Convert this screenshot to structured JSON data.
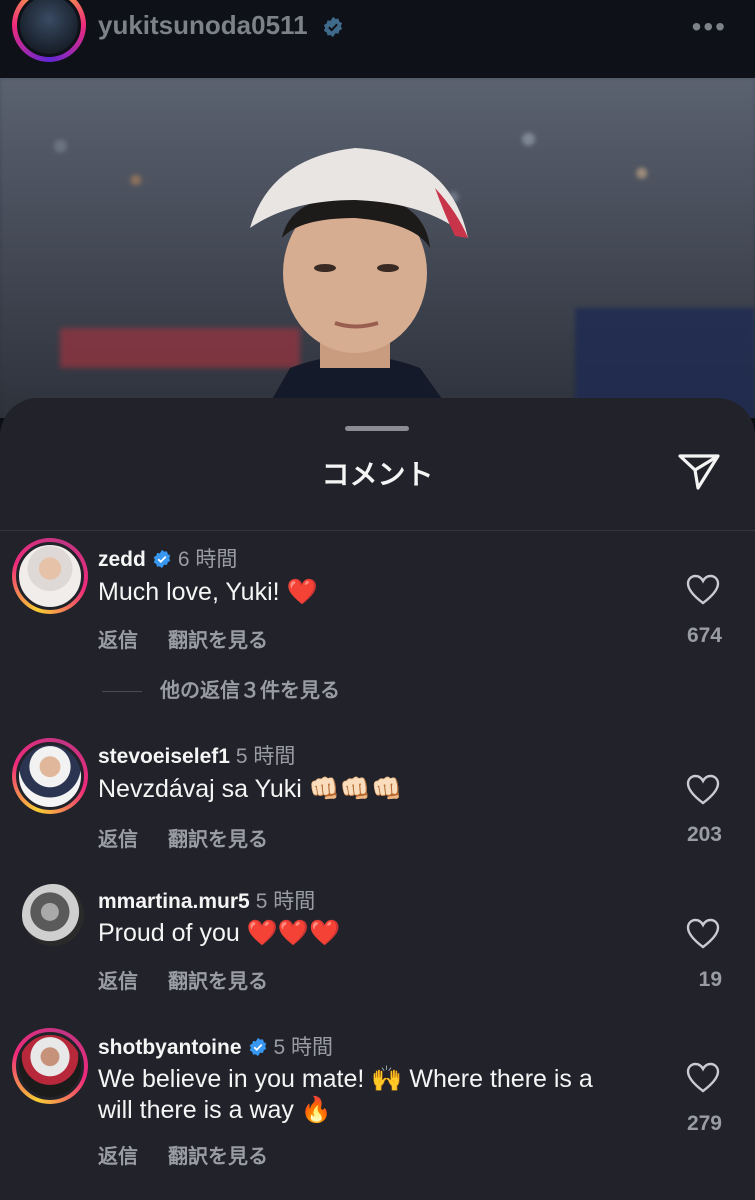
{
  "post": {
    "username": "yukitsunoda0511",
    "more_icon": "more-horizontal-icon"
  },
  "sheet": {
    "title": "コメント",
    "send_icon": "send-icon"
  },
  "comments": [
    {
      "user": "zedd",
      "verified": true,
      "time": "6 時間",
      "text": "Much love, Yuki!",
      "emoji": "❤️",
      "reply": "返信",
      "translate": "翻訳を見る",
      "likes": "674",
      "more_replies": "他の返信３件を見る"
    },
    {
      "user": "stevoeiselef1",
      "verified": false,
      "time": "5 時間",
      "text": "Nevzdávaj sa Yuki",
      "emoji": "👊🏻👊🏻👊🏻",
      "reply": "返信",
      "translate": "翻訳を見る",
      "likes": "203"
    },
    {
      "user": "mmartina.mur5",
      "verified": false,
      "time": "5 時間",
      "text": "Proud of you",
      "emoji": "❤️❤️❤️",
      "reply": "返信",
      "translate": "翻訳を見る",
      "likes": "19"
    },
    {
      "user": "shotbyantoine",
      "verified": true,
      "time": "5 時間",
      "text_line1": "We believe in you mate! 🙌 Where there is a",
      "text_line2": "will there is a way 🔥",
      "reply": "返信",
      "translate": "翻訳を見る",
      "likes": "279"
    }
  ],
  "colors": {
    "sheet_bg": "#22232a",
    "verified_blue": "#3897f0",
    "muted_text": "#9a9ca3"
  }
}
